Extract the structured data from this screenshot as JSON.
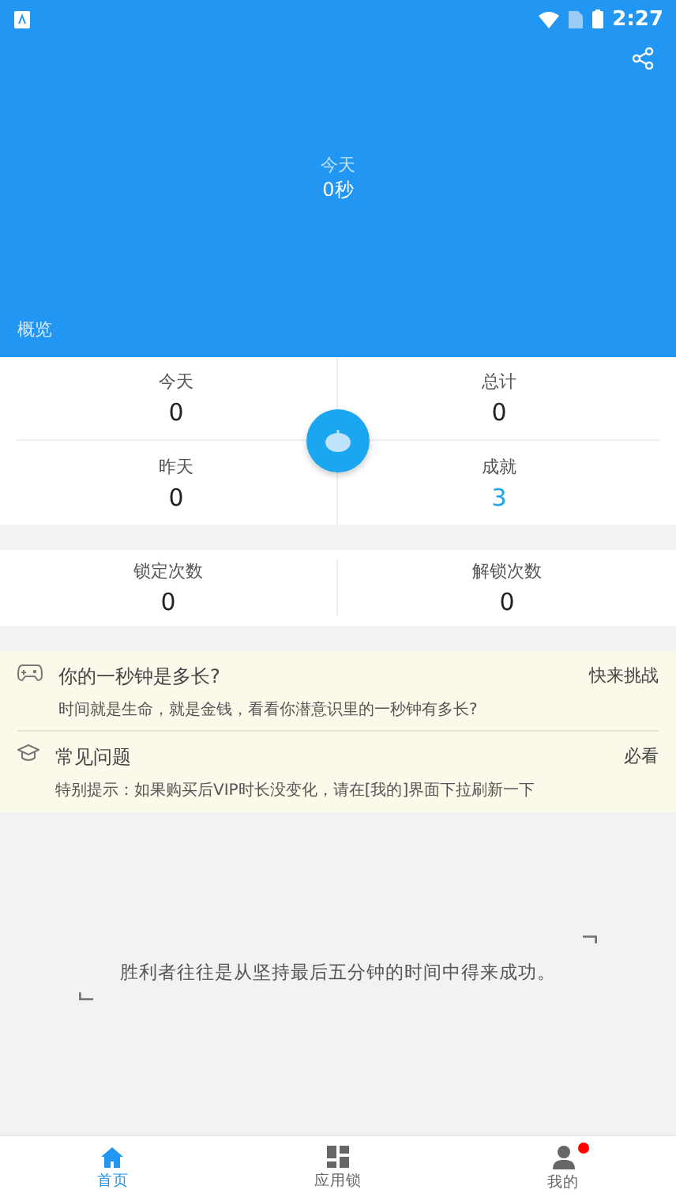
{
  "status_bar": {
    "time": "2:27"
  },
  "hero": {
    "label": "今天",
    "value": "0秒",
    "section": "概览"
  },
  "stats": [
    {
      "label": "今天",
      "value": "0",
      "highlight": false
    },
    {
      "label": "总计",
      "value": "0",
      "highlight": false
    },
    {
      "label": "昨天",
      "value": "0",
      "highlight": false
    },
    {
      "label": "成就",
      "value": "3",
      "highlight": true
    }
  ],
  "lock_stats": [
    {
      "label": "锁定次数",
      "value": "0"
    },
    {
      "label": "解锁次数",
      "value": "0"
    }
  ],
  "features": [
    {
      "kind": "game",
      "title": "你的一秒钟是多长?",
      "subtitle": "时间就是生命，就是金钱，看看你潜意识里的一秒钟有多长?",
      "action": "快来挑战"
    },
    {
      "kind": "faq",
      "title": "常见问题",
      "subtitle": "特别提示：如果购买后VIP时长没变化，请在[我的]界面下拉刷新一下",
      "action": "必看"
    }
  ],
  "quote": "胜利者往往是从坚持最后五分钟的时间中得来成功。",
  "nav": [
    {
      "kind": "home",
      "label": "首页",
      "selected": true,
      "badge": false
    },
    {
      "kind": "apps",
      "label": "应用锁",
      "selected": false,
      "badge": false
    },
    {
      "kind": "user",
      "label": "我的",
      "selected": false,
      "badge": true
    }
  ]
}
